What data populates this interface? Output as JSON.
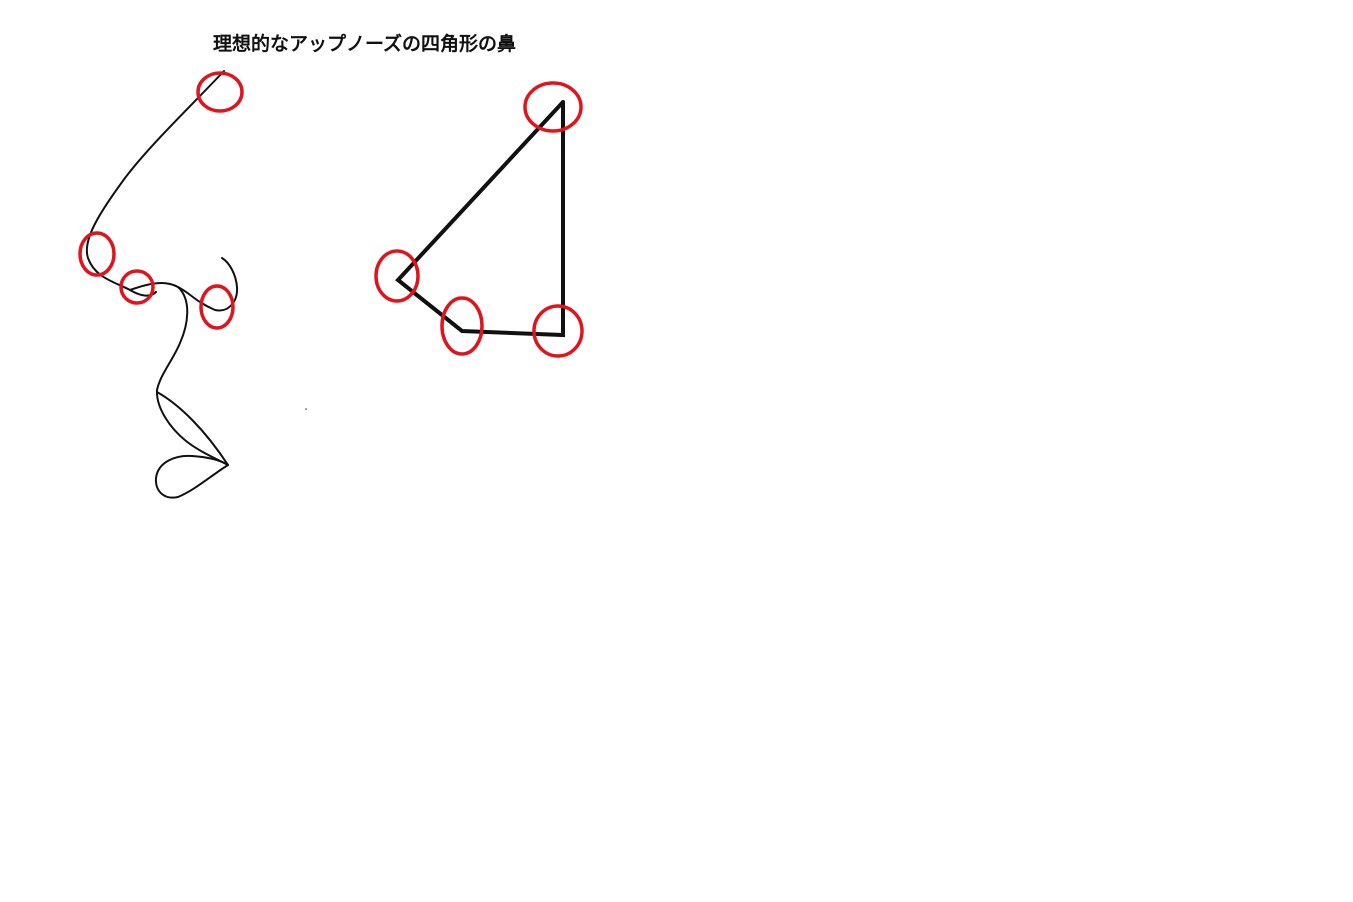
{
  "title": "理想的なアップノーズの四角形の鼻",
  "colors": {
    "line": "#111111",
    "marker": "#e0141c",
    "background": "#ffffff"
  }
}
